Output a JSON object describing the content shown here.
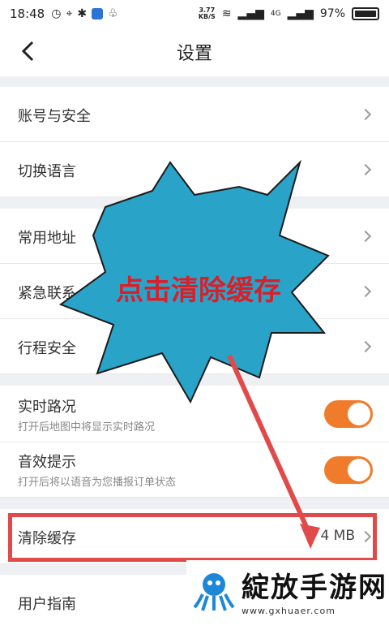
{
  "status_bar": {
    "time": "18:48",
    "speed_value": "3.77",
    "speed_unit": "KB/S",
    "battery": "97%",
    "network": "4G"
  },
  "header": {
    "title": "设置"
  },
  "groups": [
    {
      "items": [
        {
          "label": "账号与安全"
        },
        {
          "label": "切换语言"
        }
      ]
    },
    {
      "items": [
        {
          "label": "常用地址"
        },
        {
          "label": "紧急联系"
        },
        {
          "label": "行程安全"
        }
      ]
    },
    {
      "items": [
        {
          "label": "实时路况",
          "sub": "打开后地图中将显示实时路况",
          "toggle_on": true
        },
        {
          "label": "音效提示",
          "sub": "打开后将以语音为您播报订单状态",
          "toggle_on": true
        }
      ]
    },
    {
      "items": [
        {
          "label": "清除缓存",
          "value": "4 MB"
        }
      ]
    },
    {
      "items": [
        {
          "label": "用户指南"
        }
      ]
    }
  ],
  "annotation": {
    "callout_text": "点击清除缓存",
    "callout_color": "#2aa3c9",
    "highlight_color": "#e04a4a",
    "text_color": "#d8202a"
  },
  "watermark": {
    "text": "綻放手游网",
    "url": "www.gxhuaer.com"
  },
  "colors": {
    "toggle_on": "#f07b2a",
    "background": "#eef0f3"
  }
}
